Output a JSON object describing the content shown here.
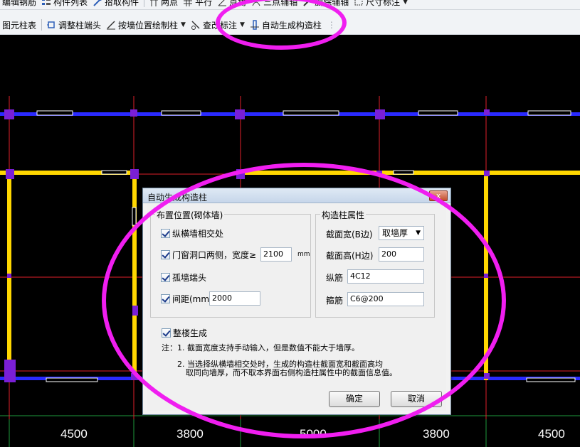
{
  "toolbar_top": {
    "items": [
      {
        "label": "编辑钢筋",
        "icon": "edit-rebar-icon"
      },
      {
        "label": "构件列表",
        "icon": "component-list-icon"
      },
      {
        "label": "拾取构件",
        "icon": "pick-component-icon"
      },
      {
        "label": "两点",
        "icon": "two-point-icon"
      },
      {
        "label": "平行",
        "icon": "parallel-icon"
      },
      {
        "label": "点角",
        "icon": "point-angle-icon"
      },
      {
        "label": "三点辅轴",
        "icon": "three-point-axis-icon"
      },
      {
        "label": "删除辅轴",
        "icon": "delete-axis-icon"
      },
      {
        "label": "尺寸标注",
        "icon": "dimension-icon"
      }
    ]
  },
  "toolbar_second": {
    "items": [
      {
        "label": "图元柱表",
        "icon": "column-table-icon"
      },
      {
        "label": "调整柱端头",
        "icon": "adjust-column-end-icon"
      },
      {
        "label": "按墙位置绘制柱",
        "icon": "draw-column-by-wall-icon"
      },
      {
        "label": "查改标注",
        "icon": "edit-annotation-icon"
      },
      {
        "label": "自动生成构造柱",
        "icon": "auto-generate-column-icon"
      }
    ]
  },
  "canvas": {
    "dimensions": [
      "4500",
      "3800",
      "5000",
      "3800",
      "4500"
    ],
    "colors": {
      "background": "#000000",
      "wall": "#ffd700",
      "axis": "#e0202a",
      "grid": "#1e9a3c",
      "column": "#7a1fd6",
      "blue_wall": "#3a3aff",
      "highlight": "#f01ef0"
    }
  },
  "dialog": {
    "title": "自动生成构造柱",
    "close_label": "x",
    "placement_group": {
      "title": "布置位置(砌体墙)",
      "cross_wall_label": "纵横墙相交处",
      "door_window_label": "门窗洞口两侧，宽度≥",
      "door_window_value": "2100",
      "door_window_unit": "mm",
      "isolated_wall_label": "孤墙端头",
      "spacing_label": "间距(mm)",
      "spacing_value": "2000"
    },
    "property_group": {
      "title": "构造柱属性",
      "width_label": "截面宽(B边)",
      "width_value": "取墙厚",
      "height_label": "截面高(H边)",
      "height_value": "200",
      "longitudinal_label": "纵筋",
      "longitudinal_value": "4C12",
      "stirrup_label": "箍筋",
      "stirrup_value": "C6@200"
    },
    "whole_building_label": "整楼生成",
    "note_1": "注：1. 截面宽度支持手动输入，但是数值不能大于墙厚。",
    "note_2_line1": "2. 当选择纵横墙相交处时，生成的构造柱截面宽和截面高均",
    "note_2_line2": "取同向墙厚，而不取本界面右侧构造柱属性中的截面信息值。",
    "ok_label": "确定",
    "cancel_label": "取消"
  }
}
